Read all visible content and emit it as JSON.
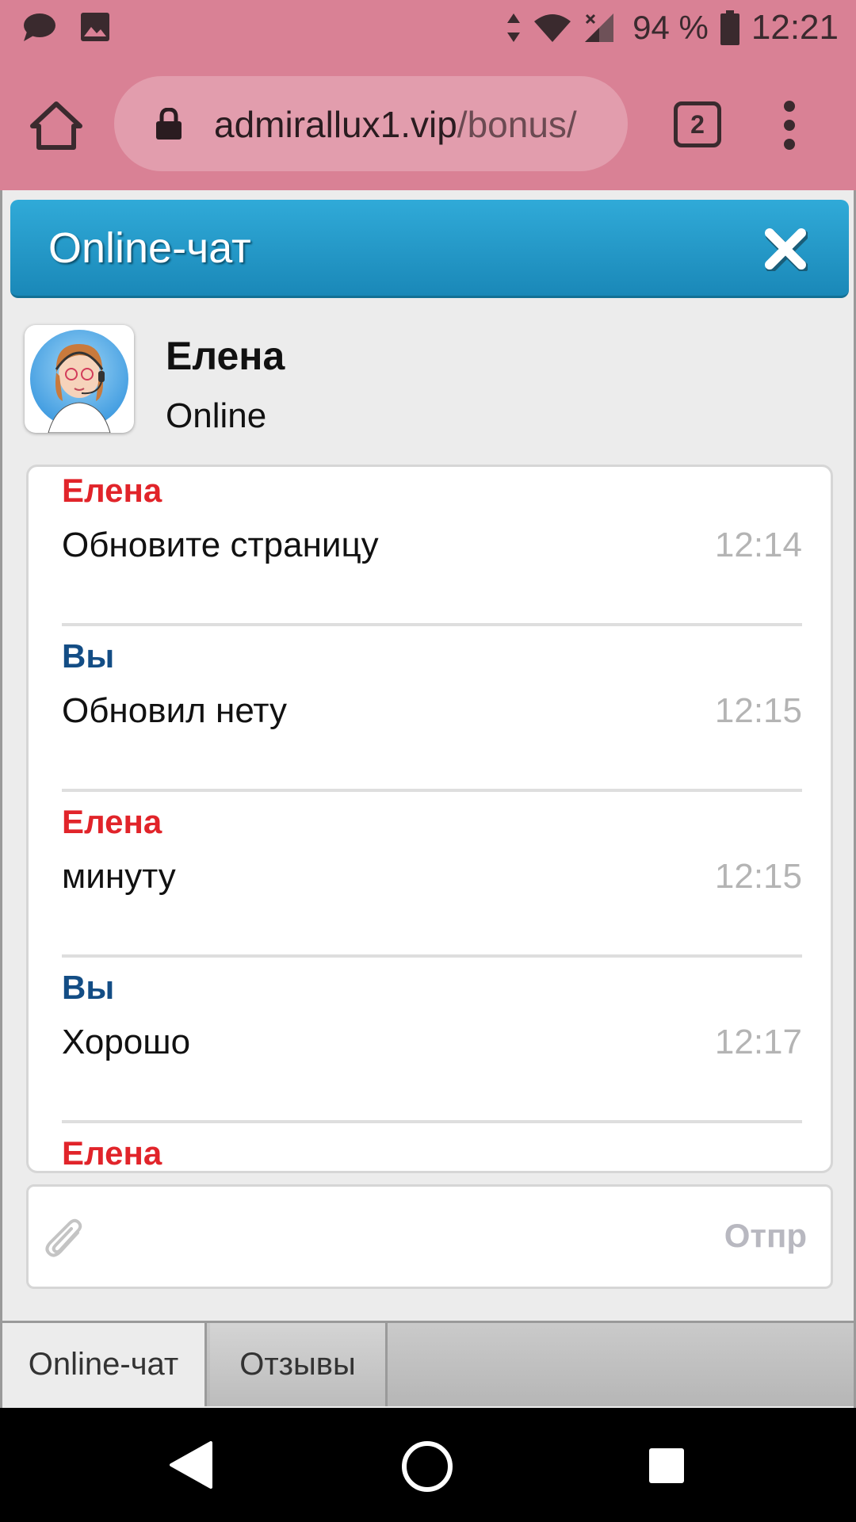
{
  "status_bar": {
    "battery": "94 %",
    "time": "12:21",
    "icons": [
      "chat-bubble-icon",
      "image-icon",
      "data-arrows-icon",
      "wifi-icon",
      "signal-icon",
      "battery-icon"
    ]
  },
  "browser": {
    "url_domain": "admirallux1.vip",
    "url_path": "/bonus/",
    "tab_count": "2"
  },
  "chat": {
    "title": "Online-чат",
    "agent_name": "Елена",
    "agent_status": "Online",
    "messages": [
      {
        "author": "Елена",
        "text": "Обновите страницу",
        "time": "12:14"
      },
      {
        "author": "Вы",
        "text": "Обновил нету",
        "time": "12:15"
      },
      {
        "author": "Елена",
        "text": "минуту",
        "time": "12:15"
      },
      {
        "author": "Вы",
        "text": "Хорошо",
        "time": "12:17"
      },
      {
        "author": "Елена",
        "text": "",
        "time": ""
      }
    ],
    "input_value": "",
    "send_label": "Отпр"
  },
  "bottom_tabs": [
    "Online-чат",
    "Отзывы"
  ],
  "colors": {
    "browser_bar": "#d98195",
    "chat_header": "#1f98c8",
    "agent_author": "#e1242a",
    "user_author": "#134d85"
  }
}
